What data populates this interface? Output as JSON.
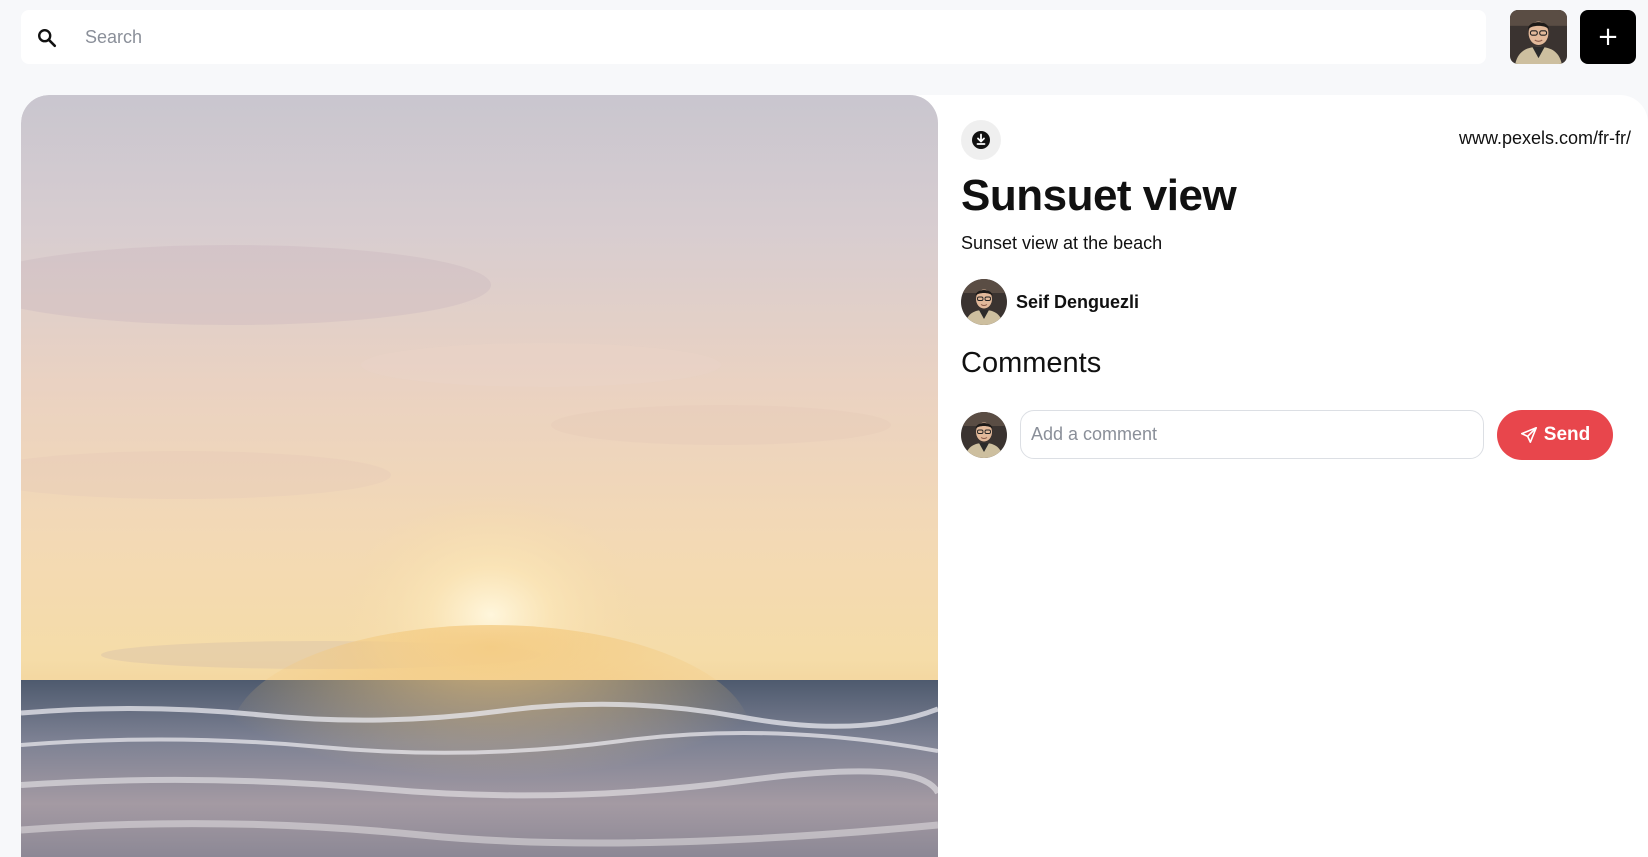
{
  "search": {
    "placeholder": "Search"
  },
  "header": {
    "add_label": "+"
  },
  "pin": {
    "source": "www.pexels.com/fr-fr/",
    "title": "Sunsuet view",
    "description": "Sunset view at the beach",
    "author": "Seif Denguezli"
  },
  "comments": {
    "heading": "Comments",
    "input_placeholder": "Add a comment",
    "send_label": "Send"
  },
  "colors": {
    "accent": "#e8464c",
    "add_button": "#000000"
  }
}
